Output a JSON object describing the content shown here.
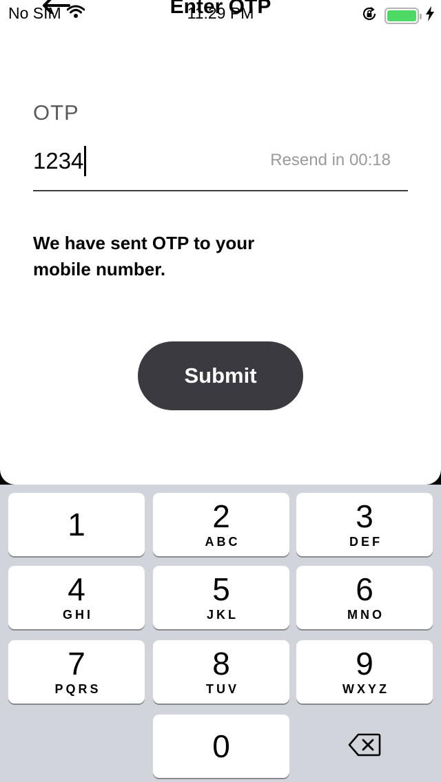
{
  "status_bar": {
    "carrier": "No SIM",
    "time": "11:29 PM",
    "battery_color": "#4cd964"
  },
  "nav": {
    "title": "Enter OTP",
    "back_icon": "back-arrow-icon"
  },
  "form": {
    "label": "OTP",
    "value": "1234",
    "resend_text": "Resend in 00:18",
    "info_text": "We have sent OTP to your mobile number.",
    "submit_label": "Submit",
    "submit_color": "#3b3a41"
  },
  "keypad": {
    "keys": [
      {
        "digit": "1",
        "letters": ""
      },
      {
        "digit": "2",
        "letters": "ABC"
      },
      {
        "digit": "3",
        "letters": "DEF"
      },
      {
        "digit": "4",
        "letters": "GHI"
      },
      {
        "digit": "5",
        "letters": "JKL"
      },
      {
        "digit": "6",
        "letters": "MNO"
      },
      {
        "digit": "7",
        "letters": "PQRS"
      },
      {
        "digit": "8",
        "letters": "TUV"
      },
      {
        "digit": "9",
        "letters": "WXYZ"
      },
      {
        "digit": "0",
        "letters": ""
      }
    ],
    "delete_icon": "backspace-icon"
  }
}
